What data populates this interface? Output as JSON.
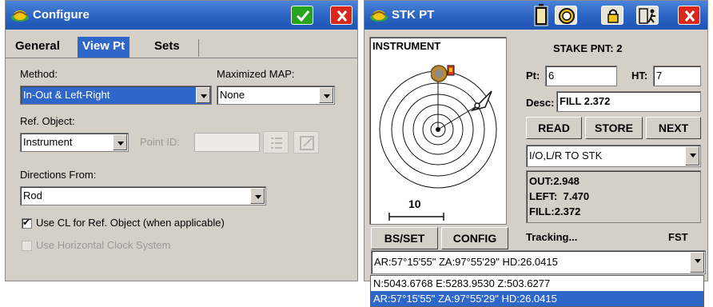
{
  "configure": {
    "title": "Configure",
    "tabs": [
      "General",
      "View Pt",
      "Sets"
    ],
    "active_tab": "View Pt",
    "method_label": "Method:",
    "method_value": "In-Out & Left-Right",
    "max_map_label": "Maximized MAP:",
    "max_map_value": "None",
    "ref_object_label": "Ref. Object:",
    "ref_object_value": "Instrument",
    "point_id_label": "Point ID:",
    "point_id_value": "",
    "directions_label": "Directions From:",
    "directions_value": "Rod",
    "use_cl_label": "Use CL for Ref. Object (when applicable)",
    "use_cl_checked": true,
    "use_clock_label": "Use Horizontal Clock System",
    "use_clock_checked": false
  },
  "stk": {
    "title": "STK PT",
    "graphic_label": "INSTRUMENT",
    "scale_value": "10",
    "stake_header": "STAKE PNT: 2",
    "pt_label": "Pt:",
    "pt_value": "6",
    "ht_label": "HT:",
    "ht_value": "7",
    "desc_label": "Desc:",
    "desc_value": "FILL 2.372",
    "read_button": "READ",
    "store_button": "STORE",
    "next_button": "NEXT",
    "mode_value": "I/O,L/R TO STK",
    "results": [
      "OUT:2.948",
      "LEFT:  7.470",
      "FILL:2.372"
    ],
    "bs_set_button": "BS/SET",
    "config_button": "CONFIG",
    "status_text": "Tracking...",
    "status_mode": "FST",
    "readout_value": "AR:57°15'55\" ZA:97°55'29\" HD:26.0415",
    "readout_options": [
      "N:5043.6768 E:5283.9530 Z:503.6277",
      "AR:57°15'55\" ZA:97°55'29\" HD:26.0415"
    ],
    "readout_selected_index": 1
  },
  "colors": {
    "titlebar": "#2a63c4",
    "selection": "#2f66c9",
    "ok_button": "#27a31f",
    "close_button": "#d8281c",
    "window_face": "#d4d0c8"
  }
}
